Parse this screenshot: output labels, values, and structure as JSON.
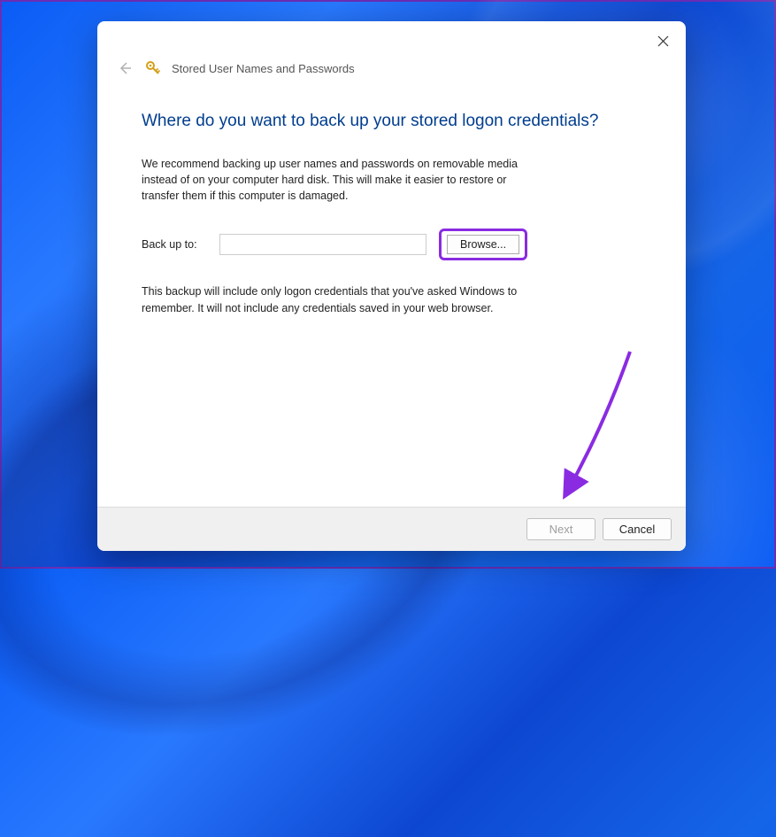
{
  "dialog": {
    "header_title": "Stored User Names and Passwords",
    "main_heading": "Where do you want to back up your stored logon credentials?",
    "description": "We recommend backing up user names and passwords on removable media instead of on your computer hard disk. This will make it easier to restore or transfer them if this computer is damaged.",
    "backup_label": "Back up to:",
    "backup_value": "",
    "browse_label": "Browse...",
    "note": "This backup will include only logon credentials that you've asked Windows to remember. It will not include any credentials saved in your web browser.",
    "next_label": "Next",
    "cancel_label": "Cancel"
  },
  "annotation": {
    "highlight_color": "#8a2be2",
    "arrow_color": "#8a2be2"
  }
}
